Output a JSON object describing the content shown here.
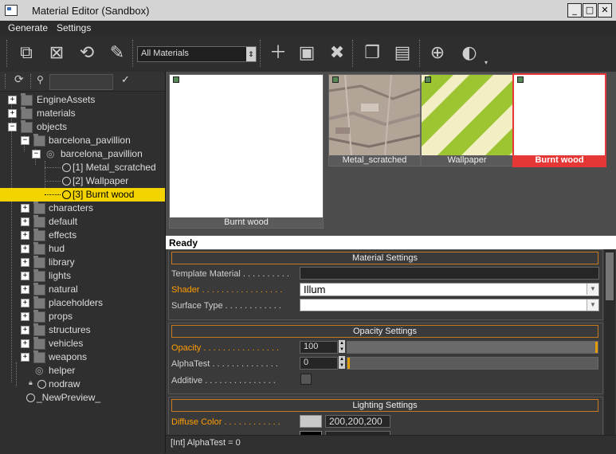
{
  "window": {
    "title": "Material Editor (Sandbox)"
  },
  "menu": {
    "generate": "Generate",
    "settings": "Settings"
  },
  "toolbar": {
    "filter_value": "All Materials"
  },
  "tree": {
    "items": [
      {
        "label": "EngineAssets"
      },
      {
        "label": "materials"
      },
      {
        "label": "objects"
      },
      {
        "label": "barcelona_pavillion"
      },
      {
        "label": "barcelona_pavillion"
      },
      {
        "label": "[1] Metal_scratched"
      },
      {
        "label": "[2] Wallpaper"
      },
      {
        "label": "[3] Burnt wood"
      },
      {
        "label": "characters"
      },
      {
        "label": "default"
      },
      {
        "label": "effects"
      },
      {
        "label": "hud"
      },
      {
        "label": "library"
      },
      {
        "label": "lights"
      },
      {
        "label": "natural"
      },
      {
        "label": "placeholders"
      },
      {
        "label": "props"
      },
      {
        "label": "structures"
      },
      {
        "label": "vehicles"
      },
      {
        "label": "weapons"
      },
      {
        "label": "helper"
      },
      {
        "label": "nodraw"
      },
      {
        "label": "_NewPreview_"
      }
    ]
  },
  "previews": {
    "large": {
      "label": "Burnt wood"
    },
    "thumbs": [
      {
        "label": "Metal_scratched"
      },
      {
        "label": "Wallpaper"
      },
      {
        "label": "Burnt wood"
      }
    ]
  },
  "status": {
    "text": "Ready"
  },
  "material_settings": {
    "header": "Material Settings",
    "template_label": "Template Material . . . . . . . . . .",
    "shader_label": "Shader . . . . . . . . . . . . . . . . .",
    "shader_value": "Illum",
    "surface_label": "Surface Type . . . . . . . . . . . .",
    "surface_value": ""
  },
  "opacity_settings": {
    "header": "Opacity Settings",
    "opacity_label": "Opacity . . . . . . . . . . . . . . . .",
    "opacity_value": "100",
    "opacity_level": 1.0,
    "alphatest_label": "AlphaTest . . . . . . . . . . . . . .",
    "alphatest_value": "0",
    "alphatest_level": 0.0,
    "additive_label": "Additive . . . . . . . . . . . . . . ."
  },
  "lighting_settings": {
    "header": "Lighting Settings",
    "diffuse_label": "Diffuse Color . . . . . . . . . . . .",
    "diffuse_value": "200,200,200",
    "diffuse_color": "#c8c8c8"
  },
  "footer": {
    "text": "[Int] AlphaTest = 0"
  },
  "colors": {
    "accent": "#ff9d00",
    "selection": "#f3d400",
    "selected_thumb": "#e63737"
  }
}
